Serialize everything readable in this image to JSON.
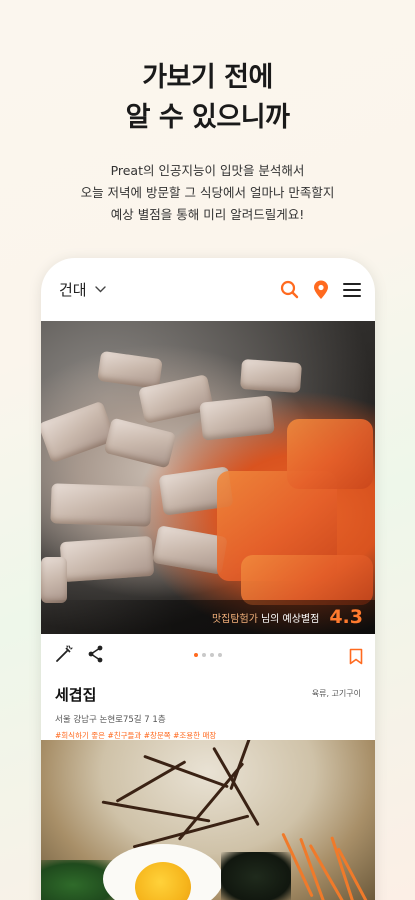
{
  "headline": {
    "line1": "가보기 전에",
    "line2": "알 수 있으니까"
  },
  "description": {
    "line1": "Preat의 인공지능이 입맛을 분석해서",
    "line2": "오늘 저녁에 방문할 그 식당에서 얼마나 만족할지",
    "line3": "예상 별점을 통해 미리 알려드릴게요!"
  },
  "appbar": {
    "location": "건대",
    "icons": [
      "chevron-down-icon",
      "search-icon",
      "location-pin-icon",
      "menu-icon"
    ],
    "accent": "#ff6a1f"
  },
  "card": {
    "rating_user": "맛집탐험가",
    "rating_label": "님의 예상별점",
    "rating_score": "4.3",
    "photo_count": 4,
    "active_photo": 1,
    "name": "세겹집",
    "category": "육류, 고기구이",
    "address": "서울 강남구 논현로75길 7 1층",
    "tags": "#회식하기 좋은 #친구들과 #창문쪽 #조용한 매장"
  }
}
